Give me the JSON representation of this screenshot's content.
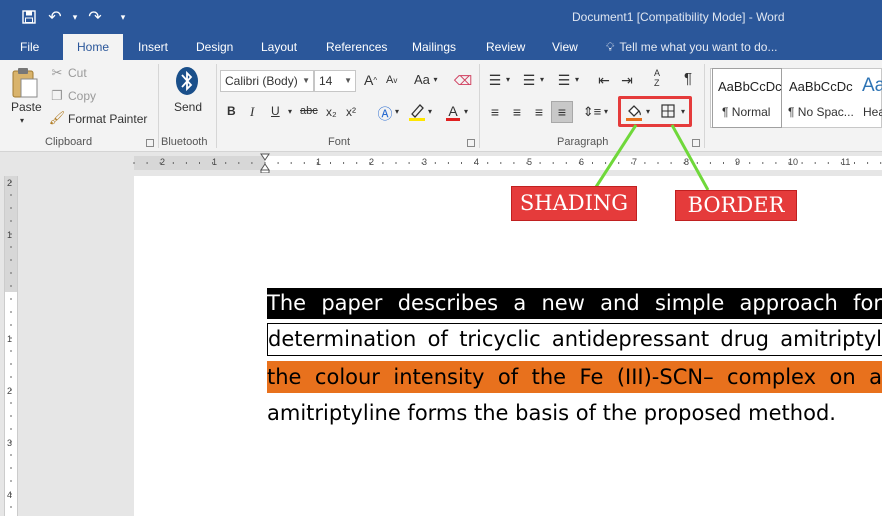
{
  "window": {
    "title": "Document1 [Compatibility Mode] - Word"
  },
  "qat": {
    "undo_icon": "undo-icon",
    "redo_icon": "redo-icon",
    "save_icon": "save-icon"
  },
  "tabs": [
    {
      "label": "File"
    },
    {
      "label": "Home"
    },
    {
      "label": "Insert"
    },
    {
      "label": "Design"
    },
    {
      "label": "Layout"
    },
    {
      "label": "References"
    },
    {
      "label": "Mailings"
    },
    {
      "label": "Review"
    },
    {
      "label": "View"
    }
  ],
  "tell_me": {
    "placeholder": "Tell me what you want to do..."
  },
  "clipboard": {
    "paste": "Paste",
    "cut": "Cut",
    "copy": "Copy",
    "format_painter": "Format Painter",
    "label": "Clipboard"
  },
  "bluetooth": {
    "send": "Send",
    "label": "Bluetooth"
  },
  "font": {
    "family": "Calibri (Body)",
    "size": "14",
    "bold": "B",
    "italic": "I",
    "underline": "U",
    "strike": "abc",
    "sub": "x₂",
    "sup": "x²",
    "grow": "A",
    "shrink": "A",
    "case": "Aa",
    "color_letter": "A",
    "label": "Font"
  },
  "paragraph": {
    "label": "Paragraph",
    "sort": "A Z",
    "pilcrow": "¶"
  },
  "styles": [
    {
      "sample": "AaBbCcDc",
      "name": "¶ Normal"
    },
    {
      "sample": "AaBbCcDc",
      "name": "¶ No Spac..."
    },
    {
      "sample": "Aa",
      "name": "Hea"
    }
  ],
  "ruler": {
    "numbers": [
      "2",
      "1",
      "1",
      "2",
      "3",
      "4",
      "5",
      "6",
      "7",
      "8",
      "9",
      "10",
      "11"
    ]
  },
  "vruler": {
    "numbers": [
      "2",
      "1",
      "1",
      "2",
      "3",
      "4"
    ]
  },
  "document": {
    "line1": [
      "The",
      "paper",
      "describes",
      "a",
      "new",
      "and",
      "simple",
      "approach",
      "for"
    ],
    "line2": [
      "determination",
      "of",
      "tricyclic",
      "antidepressant",
      "drug",
      "amitriptyl"
    ],
    "line3": [
      "the",
      "colour",
      "intensity",
      "of",
      "the",
      "Fe",
      "(III)-SCN–",
      "complex",
      "on",
      "a"
    ],
    "line4": "amitriptyline forms the basis of the proposed method."
  },
  "annotations": {
    "shading": "SHADING",
    "border": "BORDER"
  },
  "colors": {
    "accent": "#2b579a",
    "annotation_red": "#e53b3b",
    "arrow_green": "#6fd83a",
    "shading_orange": "#e8711d"
  }
}
